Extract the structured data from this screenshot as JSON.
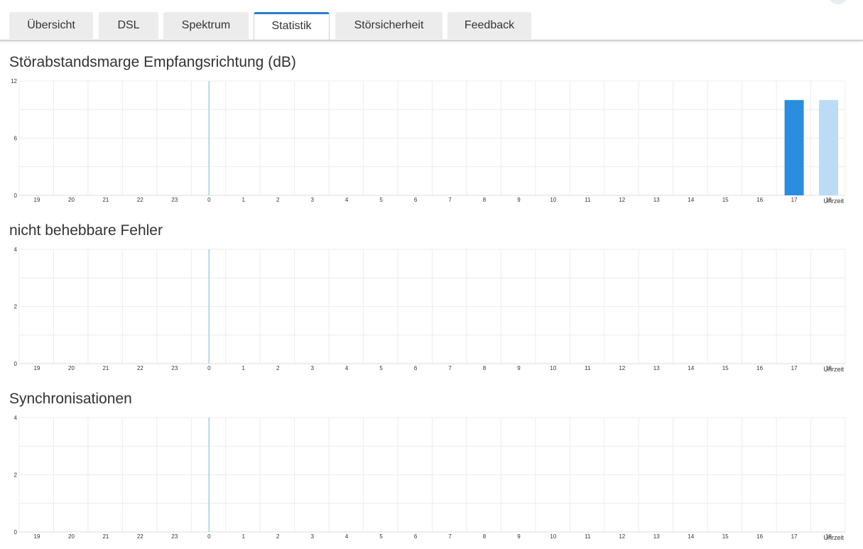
{
  "tabs": [
    {
      "label": "Übersicht",
      "active": false
    },
    {
      "label": "DSL",
      "active": false
    },
    {
      "label": "Spektrum",
      "active": false
    },
    {
      "label": "Statistik",
      "active": true
    },
    {
      "label": "Störsicherheit",
      "active": false
    },
    {
      "label": "Feedback",
      "active": false
    }
  ],
  "colors": {
    "accent": "#2a7fcf",
    "bar_primary": "#2a8de0",
    "bar_secondary": "#bcdcf5",
    "grid": "#ececec",
    "day_divider": "#b7d7f0"
  },
  "charts": [
    {
      "title": "Störabstandsmarge Empfangsrichtung (dB)"
    },
    {
      "title": "nicht behebbare Fehler"
    },
    {
      "title": "Synchronisationen"
    }
  ],
  "chart_data": [
    {
      "type": "bar",
      "title": "Störabstandsmarge Empfangsrichtung (dB)",
      "xlabel": "Uhrzeit",
      "ylabel": "",
      "categories": [
        "19",
        "20",
        "21",
        "22",
        "23",
        "0",
        "1",
        "2",
        "3",
        "4",
        "5",
        "6",
        "7",
        "8",
        "9",
        "10",
        "11",
        "12",
        "13",
        "14",
        "15",
        "16",
        "17",
        "18"
      ],
      "yticks": [
        "12",
        "6",
        "0"
      ],
      "ylim": [
        0,
        12
      ],
      "series": [
        {
          "values": [
            null,
            null,
            null,
            null,
            null,
            null,
            null,
            null,
            null,
            null,
            null,
            null,
            null,
            null,
            null,
            null,
            null,
            null,
            null,
            null,
            null,
            null,
            10,
            10
          ]
        }
      ],
      "bar_shades": [
        "primary",
        "primary",
        "primary",
        "primary",
        "primary",
        "primary",
        "primary",
        "primary",
        "primary",
        "primary",
        "primary",
        "primary",
        "primary",
        "primary",
        "primary",
        "primary",
        "primary",
        "primary",
        "primary",
        "primary",
        "primary",
        "primary",
        "primary",
        "secondary"
      ],
      "grid": true
    },
    {
      "type": "bar",
      "title": "nicht behebbare Fehler",
      "xlabel": "Uhrzeit",
      "ylabel": "",
      "categories": [
        "19",
        "20",
        "21",
        "22",
        "23",
        "0",
        "1",
        "2",
        "3",
        "4",
        "5",
        "6",
        "7",
        "8",
        "9",
        "10",
        "11",
        "12",
        "13",
        "14",
        "15",
        "16",
        "17",
        "18"
      ],
      "yticks": [
        "4",
        "2",
        "0"
      ],
      "ylim": [
        0,
        4
      ],
      "series": [
        {
          "values": [
            null,
            null,
            null,
            null,
            null,
            null,
            null,
            null,
            null,
            null,
            null,
            null,
            null,
            null,
            null,
            null,
            null,
            null,
            null,
            null,
            null,
            null,
            null,
            null
          ]
        }
      ],
      "grid": true
    },
    {
      "type": "bar",
      "title": "Synchronisationen",
      "xlabel": "Uhrzeit",
      "ylabel": "",
      "categories": [
        "19",
        "20",
        "21",
        "22",
        "23",
        "0",
        "1",
        "2",
        "3",
        "4",
        "5",
        "6",
        "7",
        "8",
        "9",
        "10",
        "11",
        "12",
        "13",
        "14",
        "15",
        "16",
        "17",
        "18"
      ],
      "yticks": [
        "4",
        "2",
        "0"
      ],
      "ylim": [
        0,
        4
      ],
      "series": [
        {
          "values": [
            null,
            null,
            null,
            null,
            null,
            null,
            null,
            null,
            null,
            null,
            null,
            null,
            null,
            null,
            null,
            null,
            null,
            null,
            null,
            null,
            null,
            null,
            null,
            null
          ]
        }
      ],
      "grid": true
    }
  ]
}
